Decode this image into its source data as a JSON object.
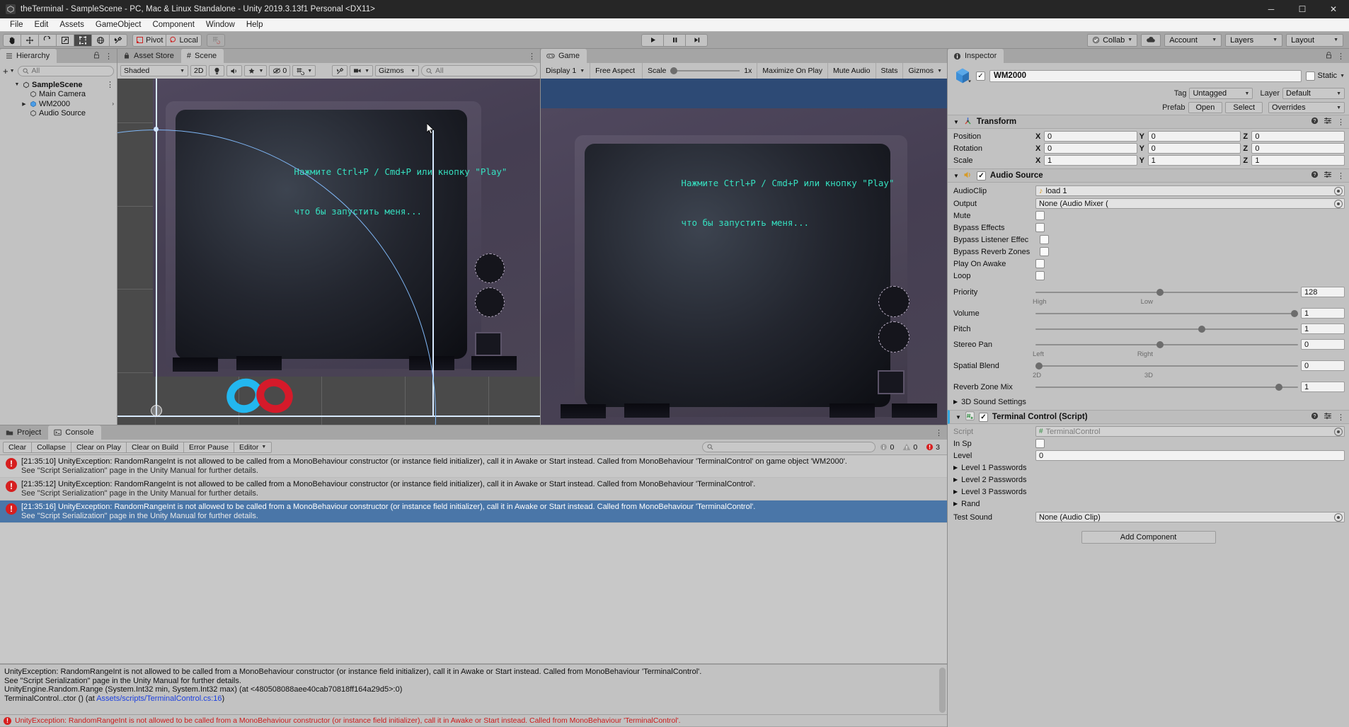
{
  "window": {
    "title": "theTerminal - SampleScene - PC, Mac & Linux Standalone - Unity 2019.3.13f1 Personal <DX11>",
    "minimize": "─",
    "maximize": "☐",
    "close": "✕"
  },
  "menu": [
    "File",
    "Edit",
    "Assets",
    "GameObject",
    "Component",
    "Window",
    "Help"
  ],
  "toolbar": {
    "tools": [
      "hand-tool",
      "move-tool",
      "rotate-tool",
      "scale-tool",
      "rect-tool",
      "transform-tool",
      "custom-tool"
    ],
    "pivot_label": "Pivot",
    "local_label": "Local",
    "grid_label": "grid-snap",
    "play": "▶",
    "pause": "‖",
    "step": "▶|",
    "collab": "Collab",
    "cloud": "cloud-icon",
    "account": "Account",
    "layers": "Layers",
    "layout": "Layout"
  },
  "hierarchy": {
    "tab": "Hierarchy",
    "search_placeholder": "All",
    "create_label": "+",
    "items": [
      {
        "label": "SampleScene",
        "depth": 0,
        "icon": "scene-icon",
        "bold": true,
        "twisty": "▼",
        "selected": false
      },
      {
        "label": "Main Camera",
        "depth": 1,
        "icon": "gameobject-icon",
        "bold": false,
        "twisty": "",
        "selected": false
      },
      {
        "label": "WM2000",
        "depth": 1,
        "icon": "prefab-icon",
        "bold": false,
        "twisty": "▶",
        "selected": false
      },
      {
        "label": "Audio Source",
        "depth": 1,
        "icon": "gameobject-icon",
        "bold": false,
        "twisty": "",
        "selected": false
      }
    ]
  },
  "scene": {
    "tabs": [
      "Asset Store",
      "Scene"
    ],
    "active_tab": "Scene",
    "shading_mode": "Shaded",
    "mode_2d": "2D",
    "lighting": "light-icon",
    "audio": "audio-icon",
    "fx": "fx-icon",
    "hidden_count": "0",
    "grid": "grid-icon",
    "gizmos_label": "Gizmos",
    "search_placeholder": "All",
    "terminal_text_line1": "Нажмите Ctrl+P / Cmd+P или кнопку \"Play\"",
    "terminal_text_line2": "что бы запустить меня..."
  },
  "game": {
    "tab": "Game",
    "display": "Display 1",
    "aspect": "Free Aspect",
    "scale_label": "Scale",
    "scale_value": "1x",
    "maximize_on_play": "Maximize On Play",
    "mute_audio": "Mute Audio",
    "stats": "Stats",
    "gizmos": "Gizmos",
    "terminal_text_line1": "Нажмите Ctrl+P / Cmd+P или кнопку \"Play\"",
    "terminal_text_line2": "что бы запустить меня..."
  },
  "console": {
    "tabs": [
      "Project",
      "Console"
    ],
    "active_tab": "Console",
    "buttons": [
      "Clear",
      "Collapse",
      "Clear on Play",
      "Clear on Build",
      "Error Pause"
    ],
    "editor_dropdown": "Editor",
    "search_placeholder": "",
    "counts": {
      "log": "0",
      "warning": "0",
      "error": "3"
    },
    "entries": [
      {
        "time": "[21:35:10]",
        "line1": "UnityException: RandomRangeInt is not allowed to be called from a MonoBehaviour constructor (or instance field initializer), call it in Awake or Start instead. Called from MonoBehaviour 'TerminalControl' on game object 'WM2000'.",
        "line2": "See \"Script Serialization\" page in the Unity Manual for further details.",
        "selected": false
      },
      {
        "time": "[21:35:12]",
        "line1": "UnityException: RandomRangeInt is not allowed to be called from a MonoBehaviour constructor (or instance field initializer), call it in Awake or Start instead. Called from MonoBehaviour 'TerminalControl'.",
        "line2": "See \"Script Serialization\" page in the Unity Manual for further details.",
        "selected": false
      },
      {
        "time": "[21:35:16]",
        "line1": "UnityException: RandomRangeInt is not allowed to be called from a MonoBehaviour constructor (or instance field initializer), call it in Awake or Start instead. Called from MonoBehaviour 'TerminalControl'.",
        "line2": "See \"Script Serialization\" page in the Unity Manual for further details.",
        "selected": true
      }
    ],
    "detail": {
      "l1": "UnityException: RandomRangeInt is not allowed to be called from a MonoBehaviour constructor (or instance field initializer), call it in Awake or Start instead. Called from MonoBehaviour 'TerminalControl'.",
      "l2": "See \"Script Serialization\" page in the Unity Manual for further details.",
      "l3": "UnityEngine.Random.Range (System.Int32 min, System.Int32 max) (at <480508088aee40cab70818ff164a29d5>:0)",
      "l4_pre": "TerminalControl..ctor () (at ",
      "l4_link": "Assets/scripts/TerminalControl.cs:16",
      "l4_post": ")"
    },
    "statusbar": "UnityException: RandomRangeInt is not allowed to be called from a MonoBehaviour constructor (or instance field initializer), call it in Awake or Start instead. Called from MonoBehaviour 'TerminalControl'."
  },
  "inspector": {
    "tab": "Inspector",
    "object_name": "WM2000",
    "enabled": true,
    "static_label": "Static",
    "tag_label": "Tag",
    "tag_value": "Untagged",
    "layer_label": "Layer",
    "layer_value": "Default",
    "prefab_label": "Prefab",
    "prefab_open": "Open",
    "prefab_select": "Select",
    "prefab_overrides": "Overrides",
    "transform": {
      "title": "Transform",
      "position_label": "Position",
      "rotation_label": "Rotation",
      "scale_label": "Scale",
      "position": {
        "x": "0",
        "y": "0",
        "z": "0"
      },
      "rotation": {
        "x": "0",
        "y": "0",
        "z": "0"
      },
      "scale": {
        "x": "1",
        "y": "1",
        "z": "1"
      }
    },
    "audio_source": {
      "title": "Audio Source",
      "enabled": true,
      "audioclip_label": "AudioClip",
      "audioclip_value": "load 1",
      "output_label": "Output",
      "output_value": "None (Audio Mixer (",
      "mute_label": "Mute",
      "mute": false,
      "bypass_effects_label": "Bypass Effects",
      "bypass_effects": false,
      "bypass_listener_label": "Bypass Listener Effec",
      "bypass_listener": false,
      "bypass_reverb_label": "Bypass Reverb Zones",
      "bypass_reverb": false,
      "play_on_awake_label": "Play On Awake",
      "play_on_awake": false,
      "loop_label": "Loop",
      "loop": false,
      "priority_label": "Priority",
      "priority_value": "128",
      "priority_min": "High",
      "priority_max": "Low",
      "volume_label": "Volume",
      "volume_value": "1",
      "pitch_label": "Pitch",
      "pitch_value": "1",
      "stereo_pan_label": "Stereo Pan",
      "stereo_pan_value": "0",
      "stereo_min": "Left",
      "stereo_max": "Right",
      "spatial_blend_label": "Spatial Blend",
      "spatial_blend_value": "0",
      "spatial_min": "2D",
      "spatial_max": "3D",
      "reverb_mix_label": "Reverb Zone Mix",
      "reverb_mix_value": "1",
      "sound_settings_label": "3D Sound Settings"
    },
    "terminal_control": {
      "title": "Terminal Control (Script)",
      "enabled": true,
      "script_label": "Script",
      "script_value": "TerminalControl",
      "in_sp_label": "In Sp",
      "in_sp": false,
      "level_label": "Level",
      "level_value": "0",
      "level1_label": "Level 1 Passwords",
      "level2_label": "Level 2 Passwords",
      "level3_label": "Level 3 Passwords",
      "rand_label": "Rand",
      "rand": false,
      "test_sound_label": "Test Sound",
      "test_sound_value": "None (Audio Clip)"
    },
    "add_component": "Add Component"
  },
  "colors": {
    "accent": "#4a76a8",
    "error": "#d61f1f",
    "link": "#1b3fe0",
    "terminal_green": "#36e0c0",
    "game_bg": "#2d4a75",
    "script_accent": "#35a8e0"
  }
}
